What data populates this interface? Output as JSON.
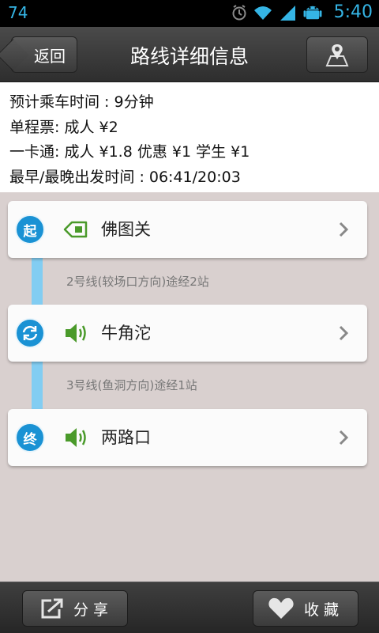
{
  "status_bar": {
    "left_text": "74",
    "time": "5:40",
    "icons": [
      "alarm-icon",
      "wifi-icon",
      "signal-icon",
      "android-debug-icon"
    ]
  },
  "header": {
    "back_label": "返回",
    "title": "路线详细信息",
    "map_icon": "map-pin-icon"
  },
  "info": {
    "lines": [
      "预计乘车时间 : 9分钟",
      "单程票: 成人 ¥2",
      "一卡通: 成人 ¥1.8 优惠 ¥1 学生 ¥1",
      "最早/最晚出发时间 : 06:41/20:03"
    ]
  },
  "route": {
    "stops": [
      {
        "badge": "起",
        "name": "佛图关",
        "icon": "station-tag-icon"
      },
      {
        "badge": "",
        "name": "牛角沱",
        "icon": "speaker-icon",
        "badge_icon": "transfer-icon"
      },
      {
        "badge": "终",
        "name": "两路口",
        "icon": "speaker-icon"
      }
    ],
    "segments": [
      "2号线(较场口方向)途经2站",
      "3号线(鱼洞方向)途经1站"
    ]
  },
  "bottom": {
    "share_label": "分享",
    "favorite_label": "收藏"
  },
  "colors": {
    "accent": "#1a92d4",
    "route_line": "#82cdf2",
    "icon_green": "#4a9a2a"
  }
}
